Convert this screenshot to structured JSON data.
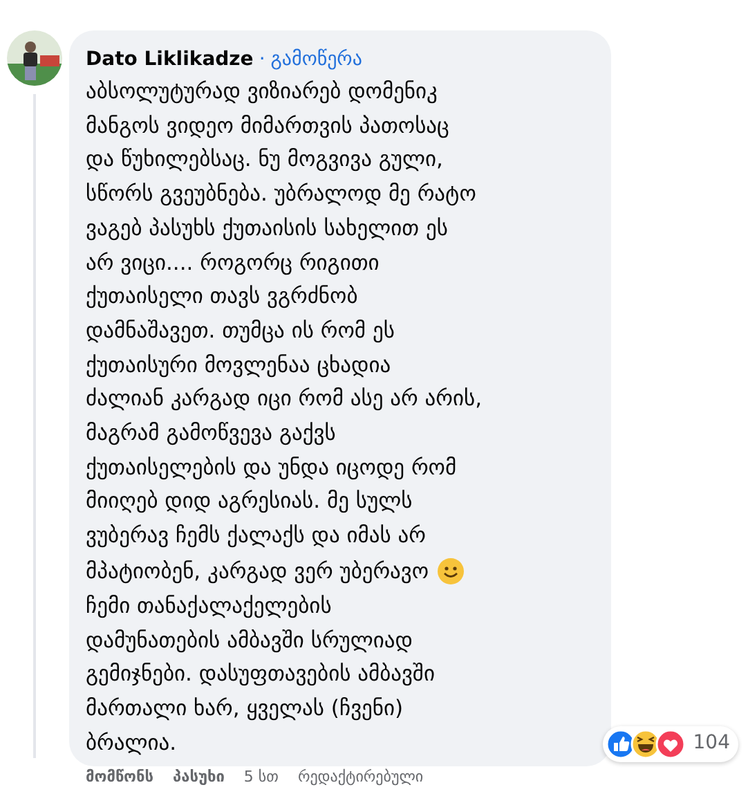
{
  "comment": {
    "author": "Dato Liklikadze",
    "separator": "·",
    "follow_link": "გამოწერა",
    "body": [
      {
        "kind": "text",
        "text": "აბსოლუტურად ვიზიარებ დომენიკ\nმანგოს ვიდეო მიმართვის პათოსაც\nდა წუხილებსაც. ნუ მოგვივა გული,\nსწორს გვეუბნება. უბრალოდ მე რატო\nვაგებ პასუხს ქუთაისის სახელით ეს\nარ ვიცი.... როგორც რიგითი\nქუთაისელი თავს ვგრძნობ\nდამნაშავეთ. თუმცა ის რომ ეს\nქუთაისური მოვლენაა ცხადია\nძალიან კარგად იცი რომ ასე არ არის,\nმაგრამ გამოწვევა გაქვს\nქუთაისელების და უნდა იცოდე რომ\nმიიღებ დიდ აგრესიას. მე სულს\nვუბერავ ჩემს ქალაქს და იმას არ"
      },
      {
        "kind": "text_with_emoji",
        "text": "მპატიობენ, კარგად ვერ უბერავო"
      },
      {
        "kind": "text",
        "text": "ჩემი თანაქალაქელების\nდამუნათების ამბავში სრულიად\nგემიჯნები. დასუფთავების ამბავში\nმართალი ხარ, ყველას (ჩვენი)\nბრალია."
      }
    ],
    "reactions": {
      "icons": [
        {
          "kind": "like"
        },
        {
          "kind": "haha"
        },
        {
          "kind": "love"
        }
      ],
      "count": "104"
    },
    "like_link": "მომწონს",
    "reply_link": "პასუხი",
    "time": "5 სთ",
    "edited": "რედაქტირებული"
  }
}
